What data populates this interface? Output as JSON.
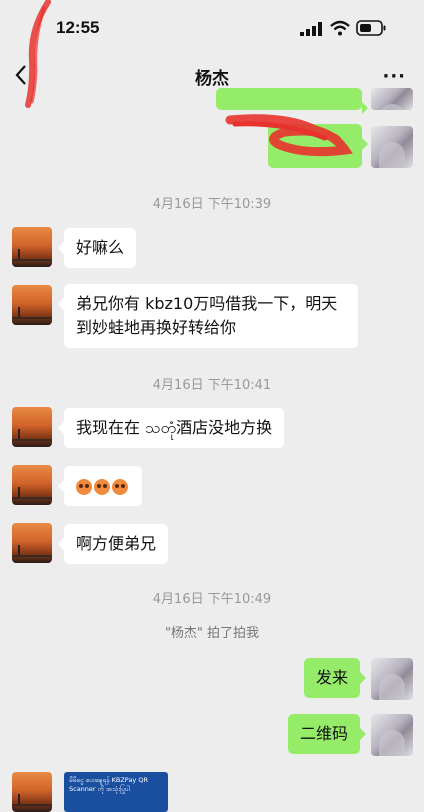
{
  "status_bar": {
    "time": "12:55"
  },
  "nav": {
    "title": "杨杰",
    "more": "···"
  },
  "messages": {
    "ts1": "4月16日 下午10:39",
    "m1": "好嘛么",
    "m2_line1": "弟兄你有 kbz10万吗借我一下，明天",
    "m2_line2": "到妙蛙地再换好转给你",
    "ts2": "4月16日 下午10:41",
    "m3": "我现在在 သတုံ酒店没地方换",
    "m5": "啊方便弟兄",
    "ts3": "4月16日 下午10:49",
    "sys": "\"杨杰\" 拍了拍我",
    "s1": "发来",
    "s2": "二维码",
    "qr_text": "မိမိငွေ ပေးချေရန် KBZPay QR Scanner ကို အသုံးပြုပါ"
  },
  "colors": {
    "bg": "#ededed",
    "bubble_self": "#95ec69",
    "bubble_other": "#ffffff",
    "scribble": "#e8322e"
  }
}
